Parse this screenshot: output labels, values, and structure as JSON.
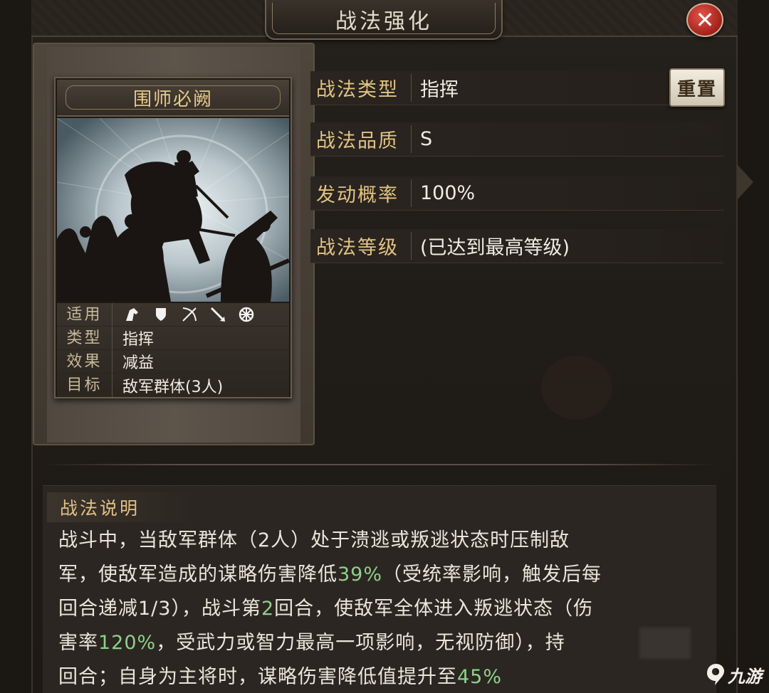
{
  "header": {
    "title": "战法强化",
    "close_symbol": "✕"
  },
  "card": {
    "name": "围师必阙",
    "stats": [
      {
        "label": "适用",
        "value": "",
        "icons": [
          "cavalry-icon",
          "shield-icon",
          "bow-icon",
          "spear-icon",
          "chariot-wheel-icon"
        ]
      },
      {
        "label": "类型",
        "value": "指挥"
      },
      {
        "label": "效果",
        "value": "减益"
      },
      {
        "label": "目标",
        "value": "敌军群体(3人)"
      }
    ]
  },
  "attributes": [
    {
      "label": "战法类型",
      "value": "指挥"
    },
    {
      "label": "战法品质",
      "value": "S"
    },
    {
      "label": "发动概率",
      "value": "100%"
    },
    {
      "label": "战法等级",
      "value": "(已达到最高等级)"
    }
  ],
  "reset_button": "重置",
  "description": {
    "title": "战法说明",
    "lines": [
      [
        {
          "t": "战斗中，当敌军群体（2人）处于溃逃或叛逃状态时压制敌"
        }
      ],
      [
        {
          "t": "军，使敌军造成的谋略伤害降低"
        },
        {
          "t": "39%",
          "hl": true
        },
        {
          "t": "（受统率影响，触发后每"
        }
      ],
      [
        {
          "t": "回合递减1/3），战斗第"
        },
        {
          "t": "2",
          "hl": true
        },
        {
          "t": "回合，使敌军全体进入叛逃状态（伤"
        }
      ],
      [
        {
          "t": "害率"
        },
        {
          "t": "120%",
          "hl": true
        },
        {
          "t": "，受武力或智力最高一项影响，无视防御），持"
        }
      ],
      [
        {
          "t": "回合；自身为主将时，谋略伤害降低值提升至"
        },
        {
          "t": "45%",
          "hl": true
        }
      ]
    ]
  },
  "watermark": "九游",
  "colors": {
    "gold_label": "#e2c383",
    "highlight_green": "#8fd08a",
    "close_red": "#c0302a"
  }
}
